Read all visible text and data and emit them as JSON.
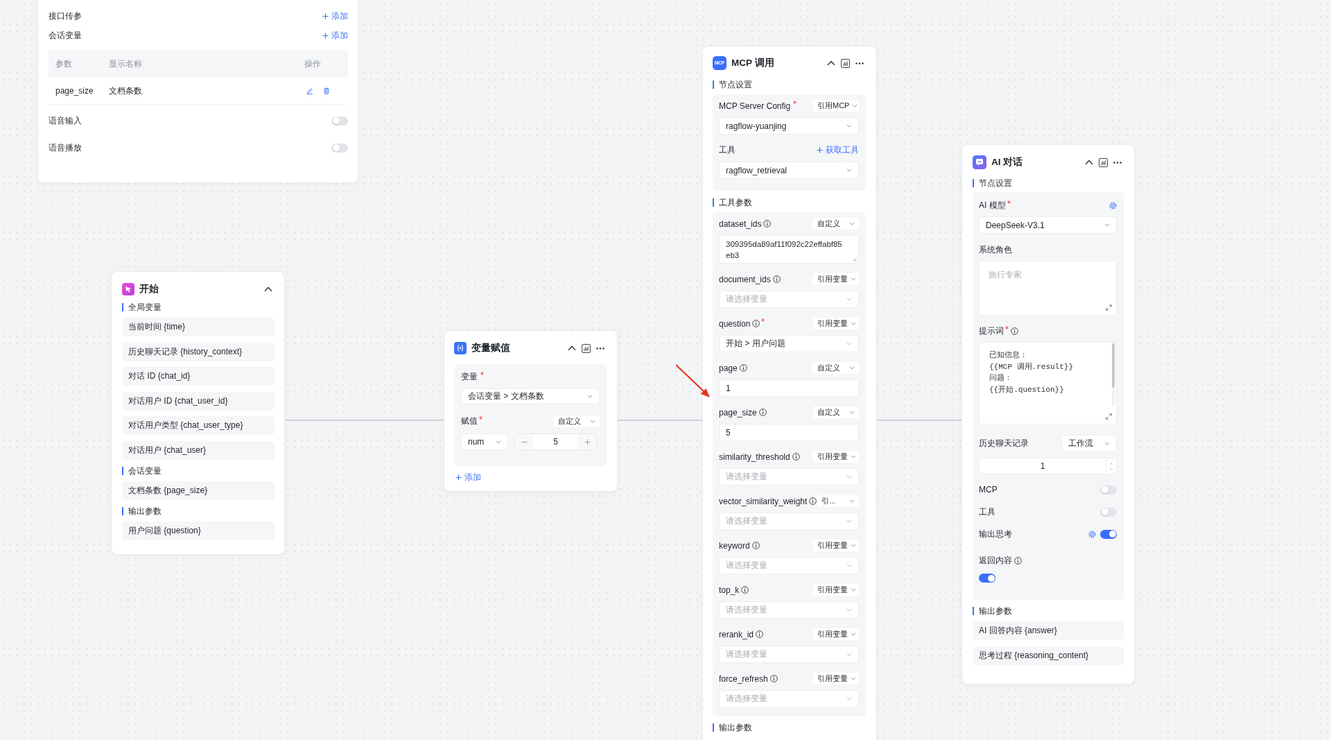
{
  "config_panel": {
    "rows": [
      {
        "label": "接口传参",
        "action": "添加"
      },
      {
        "label": "会话变量",
        "action": "添加"
      }
    ],
    "table": {
      "columns": [
        "参数",
        "显示名称",
        "操作"
      ],
      "rows": [
        {
          "cells": [
            "page_size",
            "文档条数"
          ]
        }
      ]
    },
    "toggles": [
      {
        "label": "语音输入",
        "on": false
      },
      {
        "label": "语音播放",
        "on": false
      }
    ]
  },
  "start_node": {
    "title": "开始",
    "sections": [
      {
        "title": "全局变量",
        "items": [
          "当前时间 {time}",
          "历史聊天记录 {history_context}",
          "对话 ID {chat_id}",
          "对话用户 ID {chat_user_id}",
          "对话用户类型 {chat_user_type}",
          "对话用户 {chat_user}"
        ]
      },
      {
        "title": "会话变量",
        "items": [
          "文档条数 {page_size}"
        ]
      },
      {
        "title": "输出参数",
        "items": [
          "用户问题 {question}"
        ]
      }
    ]
  },
  "assign_node": {
    "title": "变量赋值",
    "variable": {
      "label": "变量",
      "required": true,
      "value": "会话变量 > 文档条数"
    },
    "assignment": {
      "label": "赋值",
      "required": true,
      "mode": "自定义",
      "type": "num",
      "value": "5"
    },
    "add_action": "添加"
  },
  "mcp_node": {
    "icon_label": "MCP",
    "title": "MCP 调用",
    "settings_title": "节点设置",
    "server": {
      "label": "MCP Server Config",
      "required": true,
      "mode": "引用MCP",
      "value": "ragflow-yuanjing"
    },
    "tool": {
      "label": "工具",
      "action": "获取工具",
      "value": "ragflow_retrieval"
    },
    "params_title": "工具参数",
    "params": [
      {
        "name": "dataset_ids",
        "info": true,
        "required": false,
        "mode": "自定义",
        "kind": "textarea",
        "value": "309395da89af11f092c22effabf85eb3"
      },
      {
        "name": "document_ids",
        "info": true,
        "required": false,
        "mode": "引用变量",
        "kind": "select",
        "placeholder": "请选择变量"
      },
      {
        "name": "question",
        "info": true,
        "required": true,
        "mode": "引用变量",
        "kind": "select",
        "value": "开始 > 用户问题"
      },
      {
        "name": "page",
        "info": true,
        "required": false,
        "mode": "自定义",
        "kind": "input",
        "value": "1"
      },
      {
        "name": "page_size",
        "info": true,
        "required": false,
        "mode": "自定义",
        "kind": "input",
        "value": "5"
      },
      {
        "name": "similarity_threshold",
        "info": true,
        "required": false,
        "mode": "引用变量",
        "kind": "select",
        "placeholder": "请选择变量"
      },
      {
        "name": "vector_similarity_weight",
        "info": true,
        "required": false,
        "mode": "引...",
        "kind": "select",
        "placeholder": "请选择变量"
      },
      {
        "name": "keyword",
        "info": true,
        "required": false,
        "mode": "引用变量",
        "kind": "select",
        "placeholder": "请选择变量"
      },
      {
        "name": "top_k",
        "info": true,
        "required": false,
        "mode": "引用变量",
        "kind": "select",
        "placeholder": "请选择变量"
      },
      {
        "name": "rerank_id",
        "info": true,
        "required": false,
        "mode": "引用变量",
        "kind": "select",
        "placeholder": "请选择变量"
      },
      {
        "name": "force_refresh",
        "info": true,
        "required": false,
        "mode": "引用变量",
        "kind": "select",
        "placeholder": "请选择变量"
      }
    ],
    "output_title": "输出参数"
  },
  "ai_node": {
    "title": "AI 对话",
    "settings_title": "节点设置",
    "model": {
      "label": "AI 模型",
      "required": true,
      "settings": true,
      "value": "DeepSeek-V3.1"
    },
    "system_role": {
      "label": "系统角色",
      "placeholder": "旅行专家"
    },
    "prompt": {
      "label": "提示词",
      "required": true,
      "info": true,
      "value": "已知信息：\n{{MCP 调用.result}}\n问题：\n{{开始.question}}"
    },
    "history": {
      "label": "历史聊天记录",
      "mode": "工作流",
      "value": "1"
    },
    "toggles": [
      {
        "kind": "inline",
        "label": "MCP",
        "info": false,
        "settings": false,
        "on": false
      },
      {
        "kind": "inline",
        "label": "工具",
        "info": false,
        "settings": false,
        "on": false
      },
      {
        "kind": "inline",
        "label": "输出思考",
        "info": false,
        "settings": true,
        "on": true
      },
      {
        "kind": "stacked",
        "label": "返回内容",
        "info": true,
        "settings": false,
        "on": true
      }
    ],
    "output_title": "输出参数",
    "outputs": [
      "AI 回答内容 {answer}",
      "思考过程 {reasoning_content}"
    ]
  }
}
